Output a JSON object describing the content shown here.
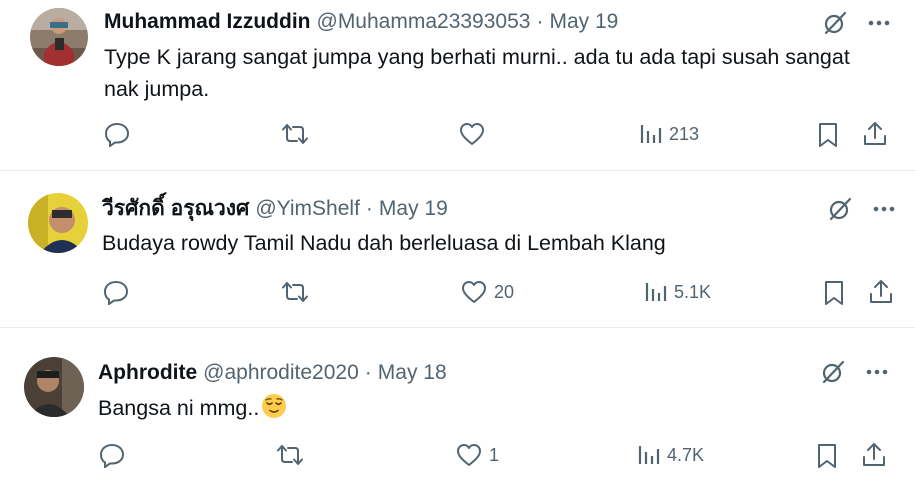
{
  "colors": {
    "text": "#0f1419",
    "secondary": "#536471",
    "divider": "#e7e9ea"
  },
  "tweets": [
    {
      "name": "Muhammad Izzuddin",
      "handle": "@Muhamma23393053",
      "separator": "·",
      "date": "May 19",
      "text": "Type K jarang sangat jumpa yang berhati murni.. ada tu ada tapi susah sangat nak jumpa.",
      "replies": "",
      "retweets": "",
      "likes": "",
      "views": "213"
    },
    {
      "name": "วีรศักดิ์ อรุณวงศ",
      "handle": "@YimShelf",
      "separator": "·",
      "date": "May 19",
      "text": "Budaya rowdy Tamil Nadu dah berleluasa di Lembah Klang",
      "replies": "",
      "retweets": "",
      "likes": "20",
      "views": "5.1K"
    },
    {
      "name": "Aphrodite",
      "handle": "@aphrodite2020",
      "separator": "·",
      "date": "May 18",
      "text": "Bangsa ni mmg..",
      "emoji": "relieved-face-emoji",
      "replies": "",
      "retweets": "",
      "likes": "1",
      "views": "4.7K"
    }
  ],
  "icons": [
    "grok-icon",
    "more-icon",
    "reply-icon",
    "retweet-icon",
    "like-icon",
    "views-icon",
    "bookmark-icon",
    "share-icon"
  ]
}
